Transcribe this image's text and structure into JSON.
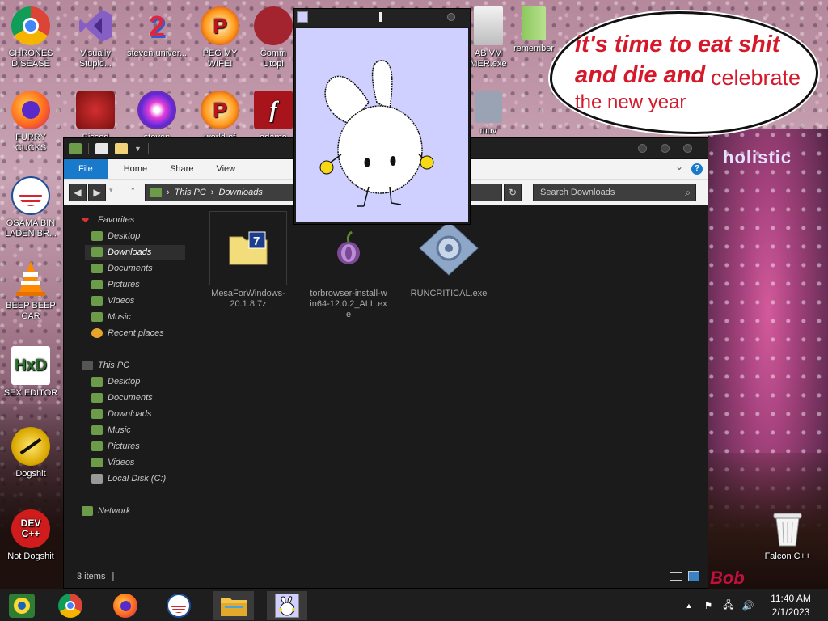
{
  "desktop": {
    "icons": [
      {
        "label": "CHRONES DISEASE",
        "icon": "chrome-icon"
      },
      {
        "label": "Visually Stupid...",
        "icon": "visual-studio-icon"
      },
      {
        "label": "steven univer...",
        "icon": "steven-universe-icon"
      },
      {
        "label": "PEG MY WIFE!",
        "icon": "peggle-icon"
      },
      {
        "label": "Comm Utopi",
        "icon": "utopia-icon"
      },
      {
        "label": "AB VM MER.exe",
        "icon": "vm-icon"
      },
      {
        "label": "remember",
        "icon": "folder-icon"
      },
      {
        "label": "FURRY CUCKS",
        "icon": "firefox-icon"
      },
      {
        "label": "Pissed",
        "icon": "angry-birds-icon"
      },
      {
        "label": "steven",
        "icon": "gem-icon"
      },
      {
        "label": "world of",
        "icon": "peggle-world-icon"
      },
      {
        "label": "adamo",
        "icon": "flash-icon"
      },
      {
        "label": "muv",
        "icon": "app-icon"
      },
      {
        "label": "OSAMA BIN LADEN BR...",
        "icon": "obama-logo-icon"
      },
      {
        "label": "BEEP BEEP CAR",
        "icon": "vlc-cone-icon"
      },
      {
        "label": "SEX EDITOR",
        "icon": "hxd-icon"
      },
      {
        "label": "Dogshit",
        "icon": "codeblocks-icon"
      },
      {
        "label": "Not Dogshit",
        "icon": "dev-cpp-icon"
      },
      {
        "label": "Falcon C++",
        "icon": "recycle-bin-icon"
      }
    ],
    "dev_cpp_text": "DEV C++",
    "hxd_text": "HxD",
    "speech_bubble": {
      "line1": "it's time to eat shit",
      "line2a": "and die and",
      "line2b": "celebrate",
      "line3": "the new year"
    },
    "wallpaper_text_1": "holistic",
    "wallpaper_text_2": "Bob"
  },
  "explorer": {
    "ribbon_tabs": [
      "File",
      "Home",
      "Share",
      "View"
    ],
    "address": {
      "crumb1": "This PC",
      "crumb2": "Downloads"
    },
    "search_placeholder": "Search Downloads",
    "sidebar": {
      "favorites_header": "Favorites",
      "favorites": [
        "Desktop",
        "Downloads",
        "Documents",
        "Pictures",
        "Videos",
        "Music",
        "Recent places"
      ],
      "thispc_header": "This PC",
      "thispc": [
        "Desktop",
        "Documents",
        "Downloads",
        "Music",
        "Pictures",
        "Videos",
        "Local Disk (C:)"
      ],
      "network": "Network"
    },
    "files": [
      {
        "name": "MesaForWindows-20.1.8.7z",
        "icon": "7z-archive-icon"
      },
      {
        "name": "torbrowser-install-win64-12.0.2_ALL.exe",
        "icon": "tor-onion-icon"
      },
      {
        "name": "RUNCRITICAL.exe",
        "icon": "exe-gear-icon"
      }
    ],
    "status": "3 items"
  },
  "taskbar": {
    "clock_time": "11:40 AM",
    "clock_date": "2/1/2023"
  },
  "colors": {
    "ribbon_file": "#1979ca",
    "bubble_text": "#d5192b",
    "bunny_bg": "#cfd0ff"
  }
}
